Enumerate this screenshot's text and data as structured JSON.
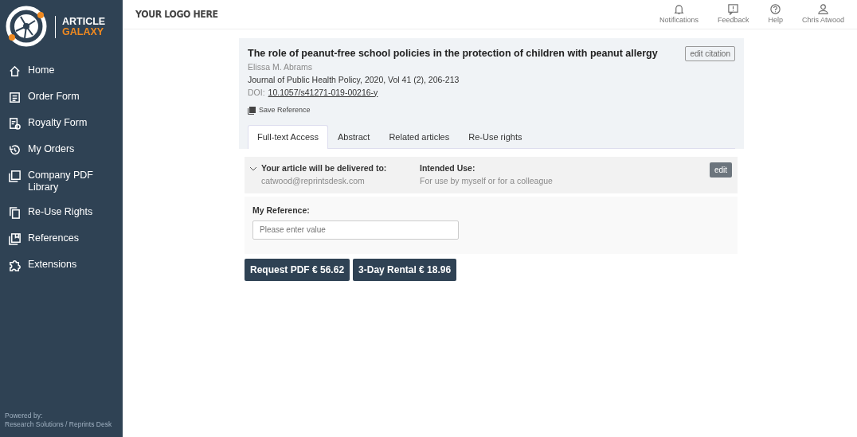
{
  "sidebar": {
    "brand": {
      "line_1": "ARTICLE",
      "line_2": "GALAXY"
    },
    "items": [
      {
        "label": "Home"
      },
      {
        "label": "Order Form"
      },
      {
        "label": "Royalty Form"
      },
      {
        "label": "My Orders"
      },
      {
        "label": "Company PDF Library"
      },
      {
        "label": "Re-Use Rights"
      },
      {
        "label": "References"
      },
      {
        "label": "Extensions"
      }
    ],
    "footer": {
      "line_1": "Powered by:",
      "line_2": "Research Solutions / Reprints Desk"
    }
  },
  "header": {
    "logo_text": "YOUR LOGO HERE",
    "actions": [
      {
        "label": "Notifications"
      },
      {
        "label": "Feedback"
      },
      {
        "label": "Help"
      },
      {
        "label": "Chris Atwood"
      }
    ]
  },
  "article": {
    "title": "The role of peanut-free school policies in the protection of children with peanut allergy",
    "edit_button": "edit citation",
    "author": "Elissa M. Abrams",
    "journal": "Journal of Public Health Policy, 2020, Vol 41 (2), 206-213",
    "doi_label": "DOI:",
    "doi": "10.1057/s41271-019-00216-y",
    "save_link": "Save Reference"
  },
  "tabs": [
    {
      "label": "Full-text Access",
      "selected": true
    },
    {
      "label": "Abstract",
      "selected": false
    },
    {
      "label": "Related articles",
      "selected": false
    },
    {
      "label": "Re-Use rights",
      "selected": false
    }
  ],
  "delivery": {
    "expanded": true,
    "delivered_label": "Your article will be delivered to:",
    "email": "catwood@reprintsdesk.com",
    "use_label": "Intended Use:",
    "use_value": "For use by myself or for a colleague",
    "edit_button": "edit"
  },
  "reference": {
    "label": "My Reference:",
    "placeholder": "Please enter value"
  },
  "buttons": [
    "Request PDF € 56.62",
    "3-Day Rental € 18.96"
  ]
}
